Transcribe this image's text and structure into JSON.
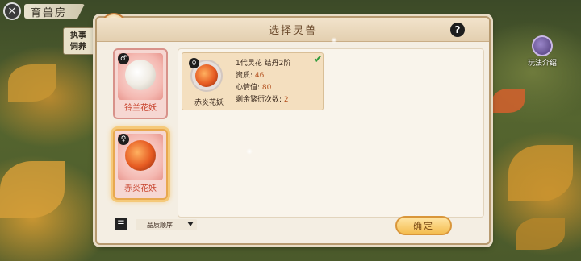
{
  "top_bar": {
    "title": "育兽房"
  },
  "side_note": {
    "line1": "执事",
    "line2": "饲养"
  },
  "guide": {
    "label": "玩法介绍"
  },
  "panel": {
    "title": "选择灵兽"
  },
  "beasts": [
    {
      "name": "铃兰花妖",
      "gender_icon": "male-icon",
      "gender_symbol": "♂",
      "selected": false
    },
    {
      "name": "赤炎花妖",
      "gender_icon": "female-icon",
      "gender_symbol": "♀",
      "selected": true
    }
  ],
  "selected_info": {
    "name": "赤炎花妖",
    "gender_symbol": "♀",
    "header": "1代灵花  结丹2阶",
    "quality_label": "资质:",
    "quality_value": "46",
    "mood_label": "心情值:",
    "mood_value": "80",
    "breed_label": "剩余繁衍次数:",
    "breed_value": "2",
    "check_symbol": "✔"
  },
  "footer": {
    "sort_label": "品质顺序",
    "confirm_label": "确定"
  },
  "colors": {
    "accent": "#f4bd50",
    "panel_bg": "#f4eee3",
    "highlight_text": "#b4511f"
  }
}
